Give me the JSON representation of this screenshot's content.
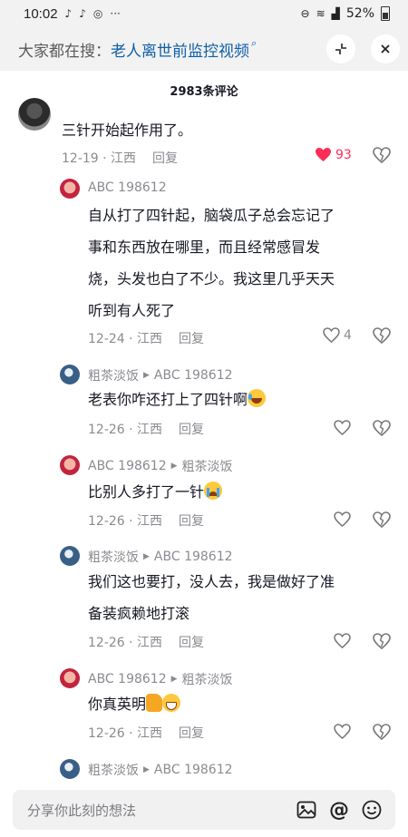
{
  "status_bar": {
    "time": "10:02",
    "notification_icons": [
      "tiktok-icon",
      "tiktok-icon",
      "whatsapp-icon",
      "more-dots"
    ],
    "battery": "52%"
  },
  "search_bar": {
    "prefix": "大家都在搜：",
    "query": "老人离世前监控视频",
    "query_icon": "search-icon"
  },
  "comments_header": {
    "title": "2983条评论"
  },
  "comments": [
    {
      "text": "三针开始起作用了。",
      "date": "12-19",
      "location": "江西",
      "reply_label": "回复",
      "likes": "93",
      "liked": true
    }
  ],
  "replies": [
    {
      "user": "ABC 198612",
      "reply_to": "",
      "lines": [
        "自从打了四针起，脑袋瓜子总会忘记了",
        "事和东西放在哪里，而且经常感冒发",
        "烧，头发也白了不少。我这里几乎天天",
        "听到有人死了"
      ],
      "date": "12-24",
      "location": "江西",
      "reply_label": "回复",
      "likes": "4"
    },
    {
      "user": "粗茶淡饭",
      "reply_to": "ABC 198612",
      "lines": [
        "老表你咋还打上了四针啊"
      ],
      "emoji": "laughing-crying-emoji",
      "date": "12-26",
      "location": "江西",
      "reply_label": "回复",
      "likes": ""
    },
    {
      "user": "ABC 198612",
      "reply_to": "粗茶淡饭",
      "lines": [
        "比别人多打了一针"
      ],
      "emoji": "crying-emoji",
      "date": "12-26",
      "location": "江西",
      "reply_label": "回复",
      "likes": ""
    },
    {
      "user": "粗茶淡饭",
      "reply_to": "ABC 198612",
      "lines": [
        "我们这也要打，没人去，我是做好了准",
        "备装疯赖地打滚"
      ],
      "date": "12-26",
      "location": "江西",
      "reply_label": "回复",
      "likes": ""
    },
    {
      "user": "ABC 198612",
      "reply_to": "粗茶淡饭",
      "lines": [
        "你真英明"
      ],
      "emoji": "thumbs-up-grin-emoji",
      "date": "12-26",
      "location": "江西",
      "reply_label": "回复",
      "likes": ""
    },
    {
      "user": "粗茶淡饭",
      "reply_to": "ABC 198612"
    }
  ],
  "input_bar": {
    "placeholder": "分享你此刻的想法",
    "icons": [
      "image-icon",
      "at-icon",
      "emoji-icon"
    ]
  },
  "colors": {
    "like_red": "#fe2c55",
    "link_blue": "#0f5fa8",
    "meta_gray": "#8a8b91"
  }
}
